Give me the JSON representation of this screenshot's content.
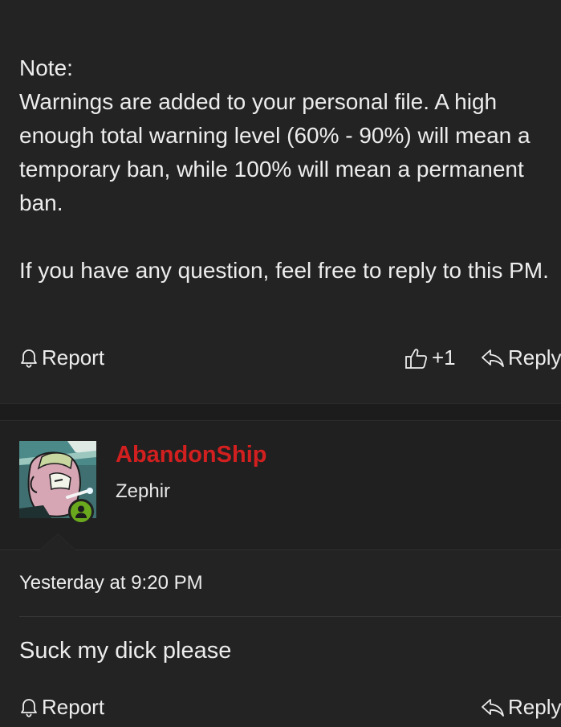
{
  "first_post": {
    "paragraphs": [
      "Note:",
      "Warnings are added to your personal file. A high enough total warning level (60% - 90%) will mean a temporary ban, while 100% will mean a permanent ban.",
      "If you have any question, feel free to reply to this PM."
    ],
    "actions": {
      "report_label": "Report",
      "like_count": "+1",
      "reply_label": "Reply"
    }
  },
  "second_post": {
    "author": {
      "username": "AbandonShip",
      "user_title": "Zephir",
      "status": "online",
      "username_color": "#d21f1f",
      "online_color": "#6aa81e"
    },
    "timestamp": "Yesterday at 9:20 PM",
    "message": "Suck my dick please",
    "actions": {
      "report_label": "Report",
      "reply_label": "Reply"
    }
  },
  "icons": {
    "report": "bell-icon",
    "like": "thumbs-up-icon",
    "reply": "reply-arrow-icon",
    "online": "user-icon"
  }
}
